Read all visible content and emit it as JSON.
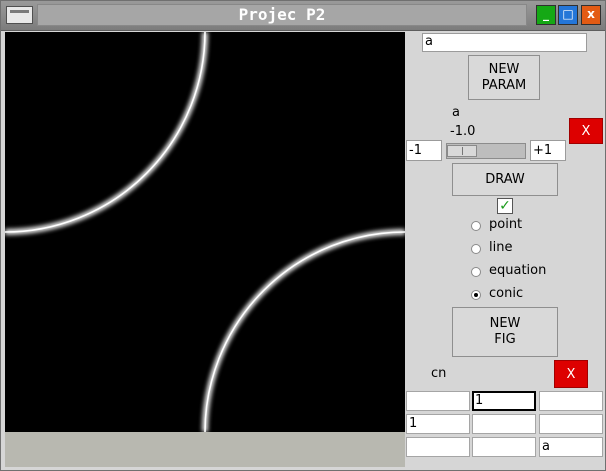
{
  "window": {
    "title": "Projec P2",
    "controls": {
      "minimize": "_",
      "maximize": "□",
      "close": "x"
    }
  },
  "param_panel": {
    "name_input_value": "a",
    "new_param_label_1": "NEW",
    "new_param_label_2": "PARAM",
    "param_name": "a",
    "param_value_display": "-1.0",
    "min_value": "-1",
    "max_value": "+1",
    "slider_value": -1.0,
    "delete_label": "X",
    "draw_label": "DRAW",
    "draw_checked": true
  },
  "figure_types": [
    {
      "label": "point",
      "selected": false
    },
    {
      "label": "line",
      "selected": false
    },
    {
      "label": "equation",
      "selected": false
    },
    {
      "label": "conic",
      "selected": true
    }
  ],
  "figure_panel": {
    "new_fig_label_1": "NEW",
    "new_fig_label_2": "FIG",
    "figure_name": "cn",
    "delete_label": "X"
  },
  "coef_grid": [
    [
      "",
      "1",
      ""
    ],
    [
      "1",
      "",
      ""
    ],
    [
      "",
      "",
      "a"
    ]
  ],
  "colors": {
    "canvas_bg": "#000000",
    "curve": "#ffffff",
    "delete_button": "#dd0000",
    "check": "#1a9a1a"
  }
}
